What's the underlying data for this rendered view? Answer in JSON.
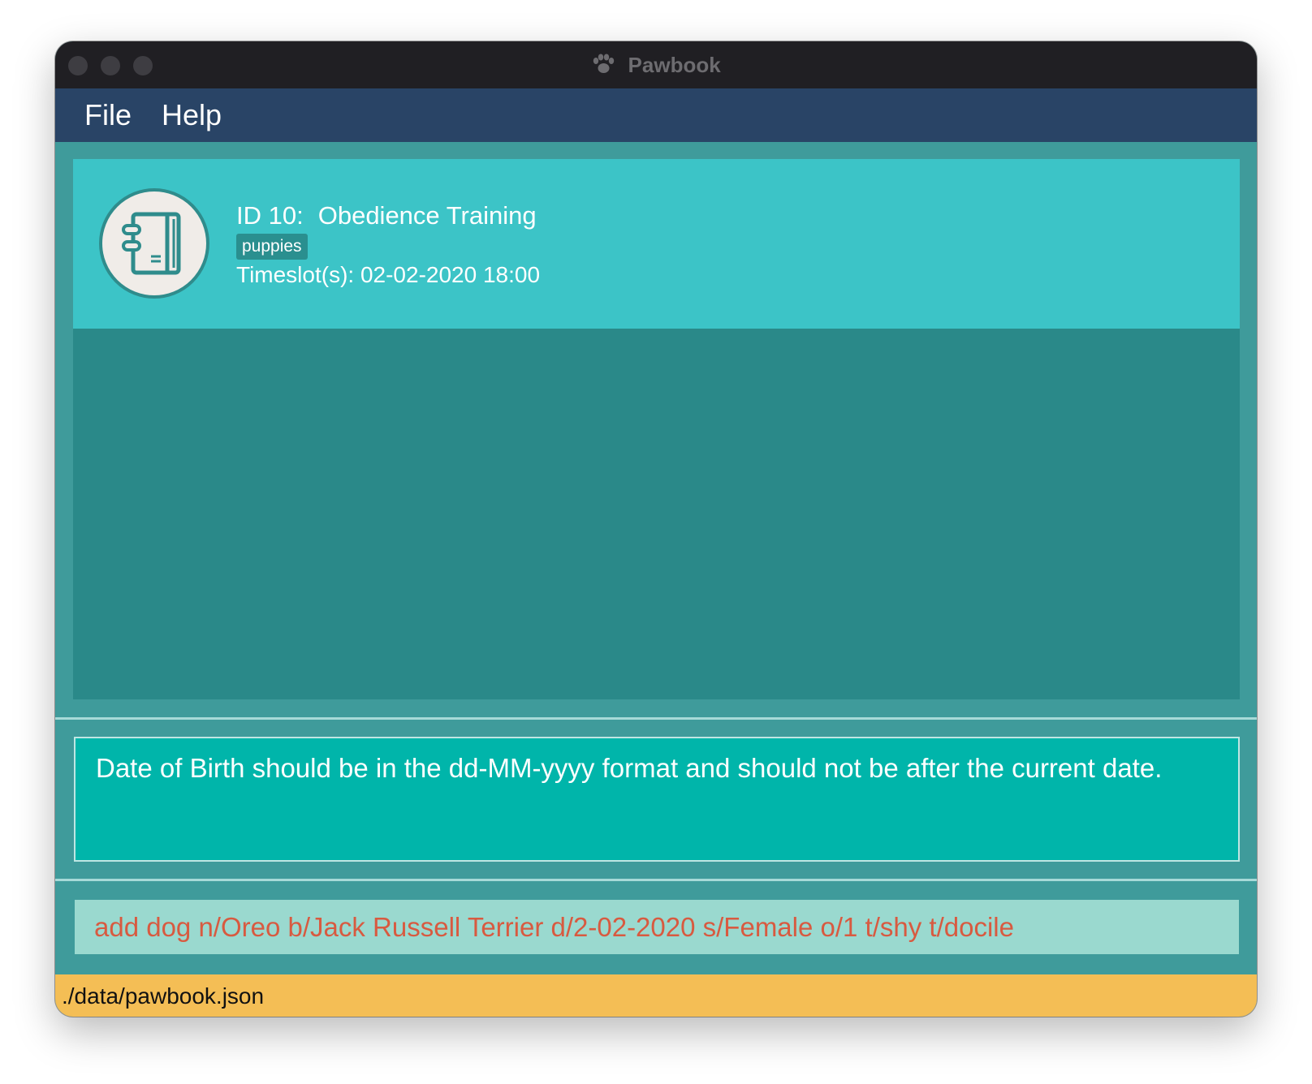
{
  "window": {
    "title": "Pawbook",
    "title_icon": "paw-icon"
  },
  "menu": {
    "file_label": "File",
    "help_label": "Help"
  },
  "program_list": {
    "items": [
      {
        "id_label": "ID 10:",
        "name": "Obedience Training",
        "tag": "puppies",
        "timeslot": "Timeslot(s): 02-02-2020 18:00",
        "icon": "notebook-icon"
      }
    ]
  },
  "result_display": {
    "message": "Date of Birth should be in the dd-MM-yyyy format and should not be after the current date."
  },
  "command_box": {
    "value": "add dog n/Oreo b/Jack Russell Terrier d/2-02-2020 s/Female o/1 t/shy t/docile"
  },
  "status_bar": {
    "file_path": "./data/pawbook.json"
  },
  "colors": {
    "menubar": "#294466",
    "card": "#3cc4c7",
    "list_bg": "#2a8989",
    "result_bg": "#00b5aa",
    "command_bg": "#9ad9cf",
    "command_text_error": "#d85a40",
    "status_bg": "#f4be55"
  }
}
